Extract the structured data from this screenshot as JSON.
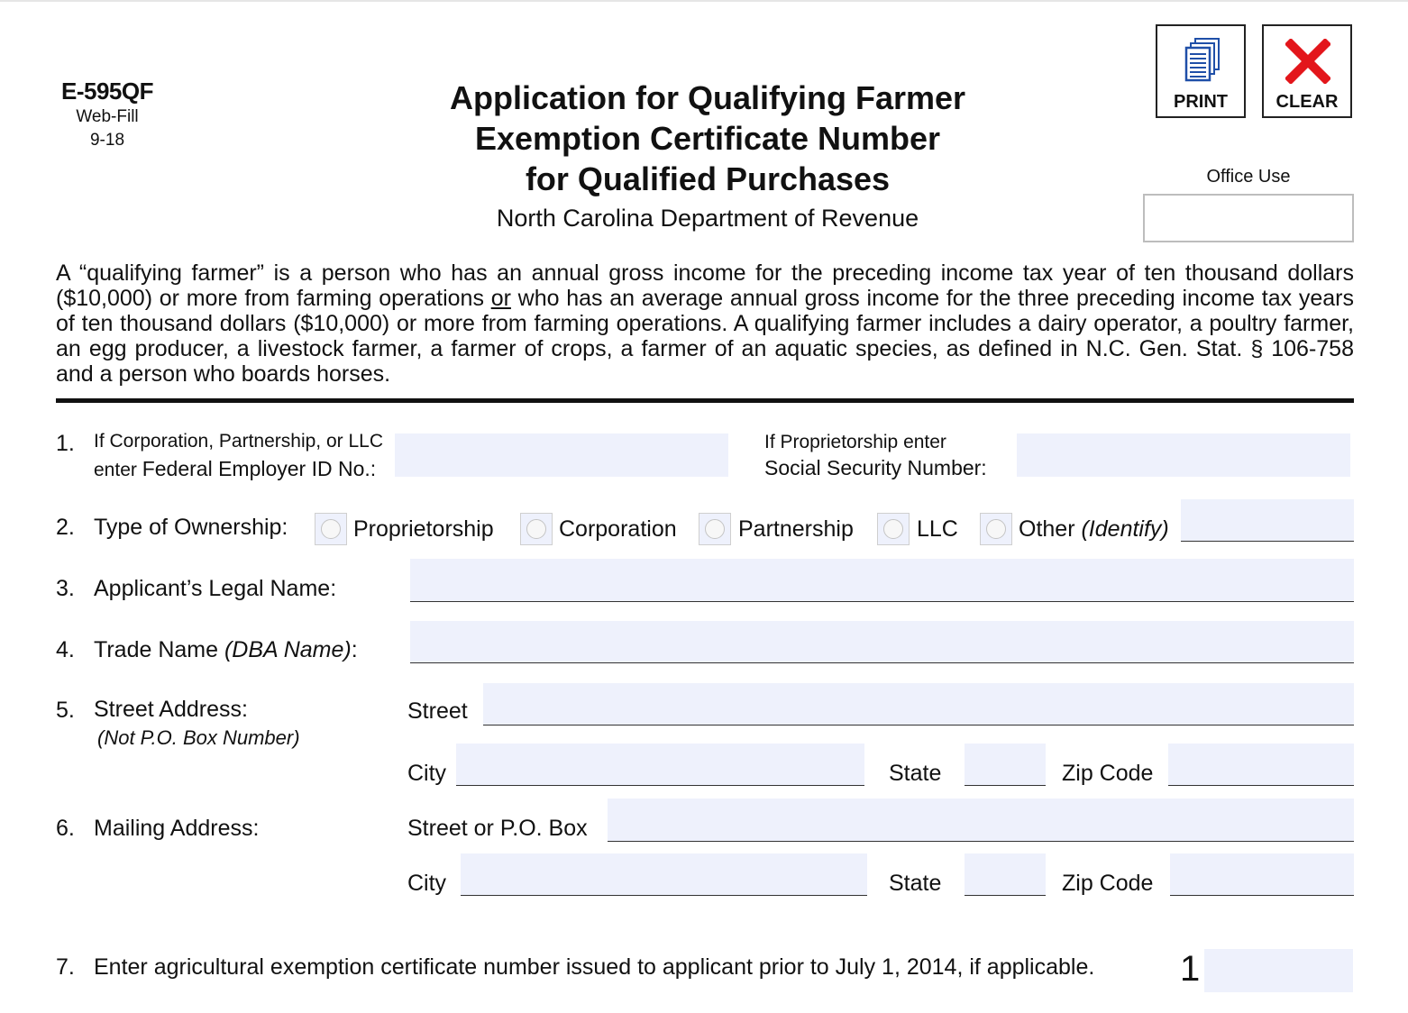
{
  "form": {
    "code": "E-595QF",
    "edition": "Web-Fill",
    "date": "9-18",
    "title_lines": [
      "Application for Qualifying Farmer",
      "Exemption Certificate Number",
      "for Qualified Purchases"
    ],
    "department": "North Carolina Department of Revenue"
  },
  "buttons": {
    "print_label": "PRINT",
    "clear_label": "CLEAR"
  },
  "office_use": {
    "label": "Office Use",
    "value": ""
  },
  "intro": {
    "part1": "A “qualifying farmer” is a person who has an annual gross income for the preceding income tax year of ten thousand dollars ($10,000) or more from farming operations ",
    "or": "or",
    "part2": " who has an average annual gross income for the three preceding income tax years of ten thousand dollars ($10,000) or more from farming operations.  A qualifying farmer includes a dairy operator, a poultry farmer, an egg producer, a livestock farmer, a farmer of crops, a farmer of an aquatic species, as defined in N.C. Gen. Stat. § 106-758 and a person who boards horses."
  },
  "line1": {
    "number": "1.",
    "fein_label_line1": "If Corporation, Partnership, or LLC",
    "fein_label_line2_prefix": "enter ",
    "fein_label_line2": "Federal Employer ID No.:",
    "fein_value": "",
    "ssn_label_line1": "If Proprietorship enter",
    "ssn_label_line2": "Social Security Number:",
    "ssn_value": ""
  },
  "line2": {
    "number": "2.",
    "label": "Type of Ownership:",
    "options": [
      "Proprietorship",
      "Corporation",
      "Partnership",
      "LLC",
      "Other"
    ],
    "other_hint": "(Identify)",
    "other_value": "",
    "selected": null
  },
  "line3": {
    "number": "3.",
    "label": "Applicant’s Legal Name:",
    "value": ""
  },
  "line4": {
    "number": "4.",
    "label": "Trade Name",
    "label_italic": "(DBA Name)",
    "label_suffix": ":",
    "value": ""
  },
  "line5": {
    "number": "5.",
    "label": "Street Address:",
    "note": "(Not P.O. Box Number)",
    "street_label": "Street",
    "street_value": "",
    "city_label": "City",
    "city_value": "",
    "state_label": "State",
    "state_value": "",
    "zip_label": "Zip Code",
    "zip_value": ""
  },
  "line6": {
    "number": "6.",
    "label": "Mailing Address:",
    "street_label": "Street or P.O. Box",
    "street_value": "",
    "city_label": "City",
    "city_value": "",
    "state_label": "State",
    "state_value": "",
    "zip_label": "Zip Code",
    "zip_value": ""
  },
  "line7": {
    "number": "7.",
    "label": "Enter agricultural exemption certificate number issued to applicant prior to July 1, 2014, if applicable.",
    "prefix": "1",
    "value": ""
  }
}
